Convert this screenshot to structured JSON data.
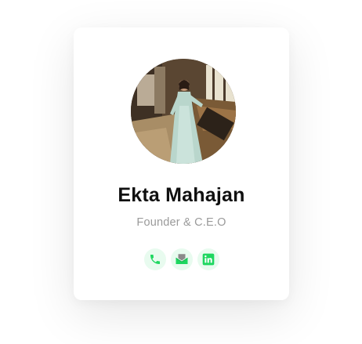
{
  "profile": {
    "name": "Ekta Mahajan",
    "role": "Founder & C.E.O"
  },
  "social_links": [
    {
      "icon": "phone-icon"
    },
    {
      "icon": "mail-icon"
    },
    {
      "icon": "linkedin-icon"
    }
  ],
  "colors": {
    "accent": "#1ed760",
    "icon_bg": "#e8fbef",
    "name": "#0f0f0f",
    "role": "#9a9a9a"
  }
}
